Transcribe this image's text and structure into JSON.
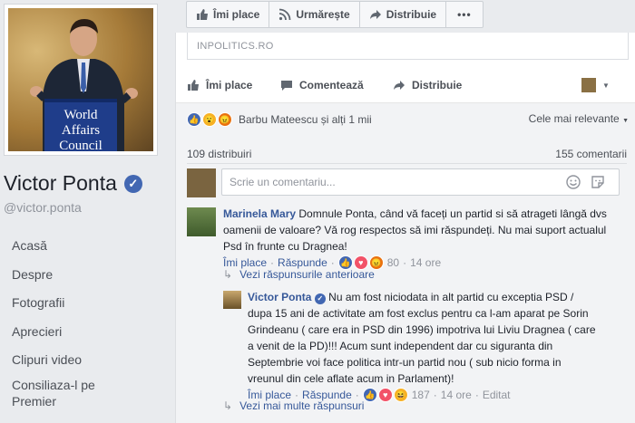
{
  "profile": {
    "name": "Victor Ponta",
    "handle": "@victor.ponta",
    "podium_text": [
      "World",
      "Affairs",
      "Council"
    ]
  },
  "sidebar": {
    "items": [
      {
        "label": "Acasă"
      },
      {
        "label": "Despre"
      },
      {
        "label": "Fotografii"
      },
      {
        "label": "Aprecieri"
      },
      {
        "label": "Clipuri video"
      },
      {
        "label": "Consiliaza-l pe Premier"
      }
    ]
  },
  "page_actions": {
    "like_label": "Îmi place",
    "follow_label": "Urmărește",
    "share_label": "Distribuie",
    "more_label": "•••"
  },
  "post": {
    "link_domain": "INPOLITICS.RO",
    "actions": {
      "like": "Îmi place",
      "comment": "Comentează",
      "share": "Distribuie"
    },
    "reactions_summary": "Barbu Mateescu și alți 1 mii",
    "sort_label": "Cele mai relevante",
    "shares": "109 distribuiri",
    "comments_count": "155 comentarii",
    "composer_placeholder": "Scrie un comentariu..."
  },
  "comments": [
    {
      "author": "Marinela Mary",
      "text": "Domnule Ponta, când vă faceți un partid si să atrageti lângă dvs oamenii de valoare? Vă rog respectos să imi răspundeți. Nu mai suport actualul Psd în frunte cu Dragnea!",
      "like_label": "Îmi place",
      "reply_label": "Răspunde",
      "reaction_count": "80",
      "time": "14 ore",
      "view_previous": "Vezi răspunsurile anterioare"
    },
    {
      "author": "Victor Ponta",
      "text": "Nu am fost niciodata in alt partid cu exceptia PSD / dupa 15 ani de activitate am fost exclus pentru ca l-am aparat pe Sorin Grindeanu ( care era in PSD din 1996) impotriva lui Liviu Dragnea ( care a venit de la PD)!!! Acum sunt independent dar cu siguranta din Septembrie voi face politica intr-un partid nou ( sub nicio forma in vreunul din cele aflate acum in Parlament)!",
      "like_label": "Îmi place",
      "reply_label": "Răspunde",
      "reaction_count": "187",
      "time": "14 ore",
      "edited": "Editat"
    }
  ],
  "more_replies": "Vezi mai multe răspunsuri",
  "colors": {
    "link_blue": "#365899",
    "fb_blue": "#4267b2",
    "muted": "#90949c",
    "background": "#e9ebee"
  }
}
